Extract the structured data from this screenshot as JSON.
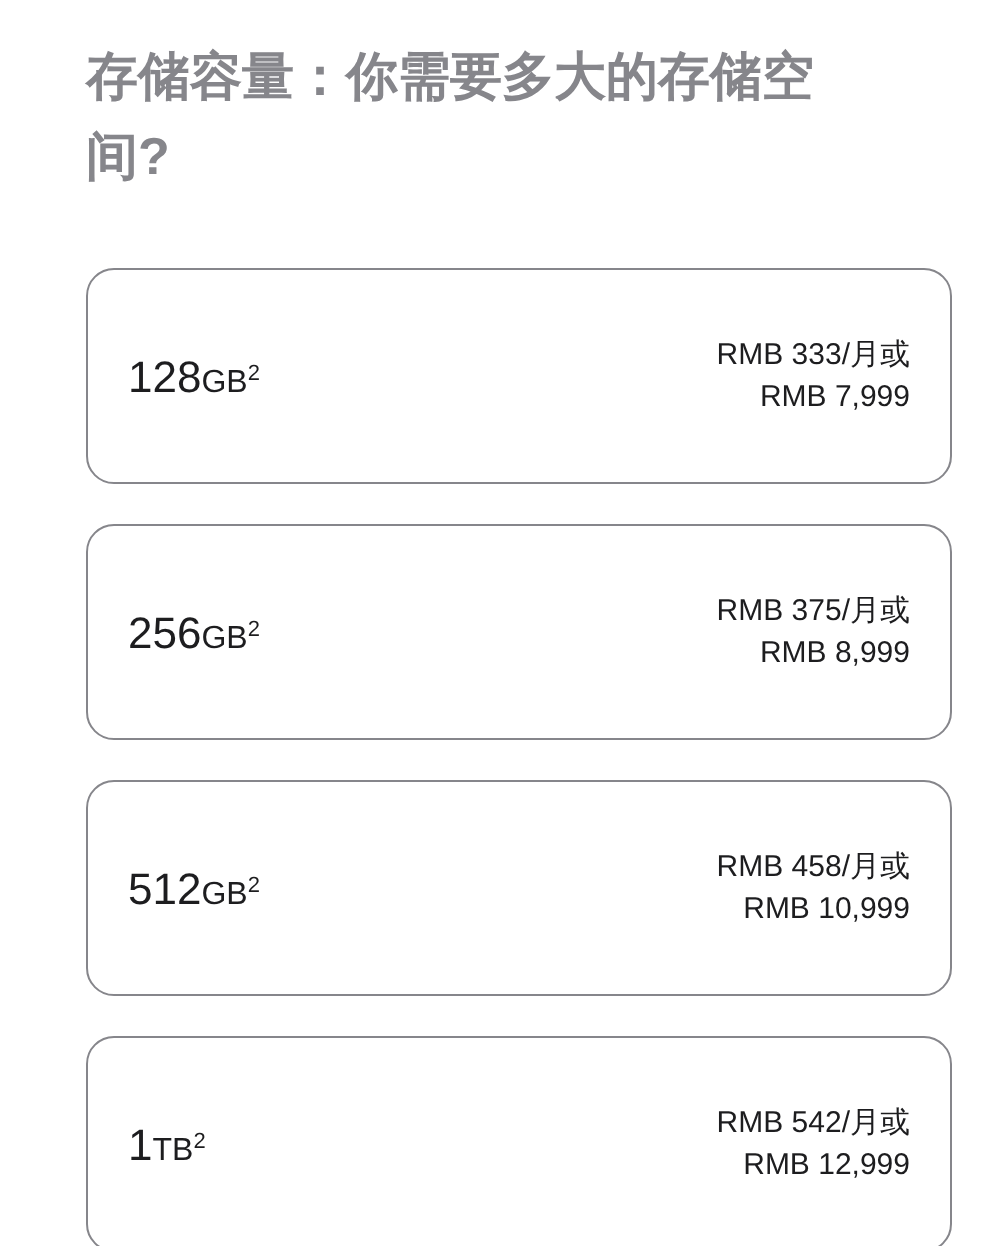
{
  "heading": "**存储容量：**你需要多大的存储空间?",
  "options": [
    {
      "amount": "128",
      "unit": "GB",
      "footnote": "2",
      "price_monthly": "RMB 333/月或",
      "price_full": "RMB 7,999"
    },
    {
      "amount": "256",
      "unit": "GB",
      "footnote": "2",
      "price_monthly": "RMB 375/月或",
      "price_full": "RMB 8,999"
    },
    {
      "amount": "512",
      "unit": "GB",
      "footnote": "2",
      "price_monthly": "RMB 458/月或",
      "price_full": "RMB 10,999"
    },
    {
      "amount": "1",
      "unit": "TB",
      "footnote": "2",
      "price_monthly": "RMB 542/月或",
      "price_full": "RMB 12,999"
    }
  ]
}
